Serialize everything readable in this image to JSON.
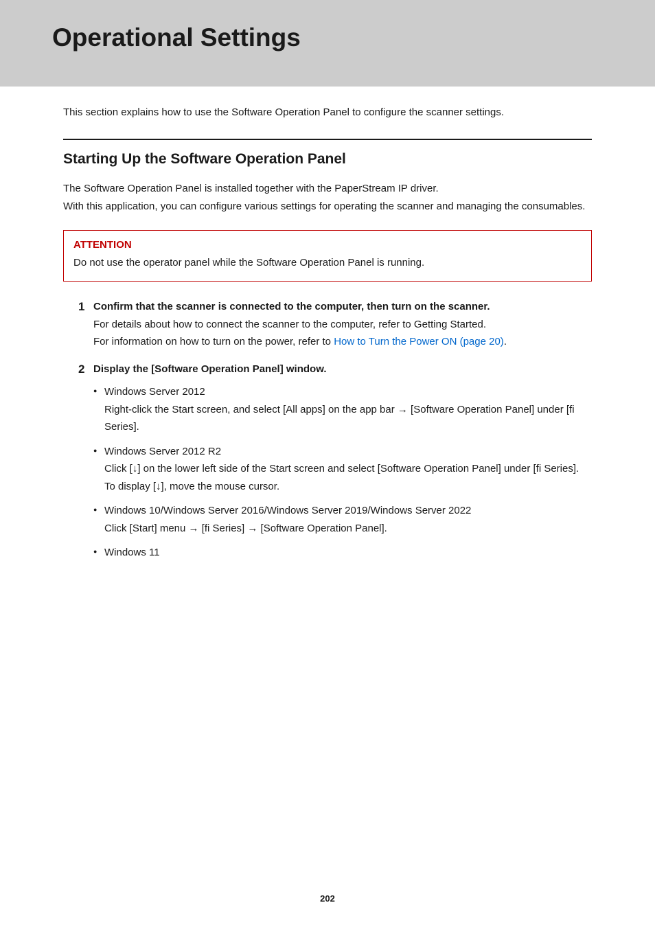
{
  "title": "Operational Settings",
  "intro": "This section explains how to use the Software Operation Panel to configure the scanner settings.",
  "section": {
    "heading": "Starting Up the Software Operation Panel",
    "body_l1": "The Software Operation Panel is installed together with the PaperStream IP driver.",
    "body_l2": "With this application, you can configure various settings for operating the scanner and managing the consumables."
  },
  "attention": {
    "label": "ATTENTION",
    "text": "Do not use the operator panel while the Software Operation Panel is running."
  },
  "steps": [
    {
      "num": "1",
      "title": "Confirm that the scanner is connected to the computer, then turn on the scanner.",
      "line1": "For details about how to connect the scanner to the computer, refer to Getting Started.",
      "line2_pre": "For information on how to turn on the power, refer to ",
      "line2_link": "How to Turn the Power ON (page 20)",
      "line2_post": "."
    },
    {
      "num": "2",
      "title": "Display the [Software Operation Panel] window.",
      "bullets": [
        {
          "head": "Windows Server 2012",
          "body": "Right-click the Start screen, and select [All apps] on the app bar → [Software Operation Panel] under [fi Series]."
        },
        {
          "head": "Windows Server 2012 R2",
          "body": "Click [↓] on the lower left side of the Start screen and select [Software Operation Panel] under [fi Series].",
          "body2": "To display [↓], move the mouse cursor."
        },
        {
          "head": "Windows 10/Windows Server 2016/Windows Server 2019/Windows Server 2022",
          "body": "Click [Start] menu → [fi Series] → [Software Operation Panel]."
        },
        {
          "head": "Windows 11"
        }
      ]
    }
  ],
  "page_number": "202"
}
